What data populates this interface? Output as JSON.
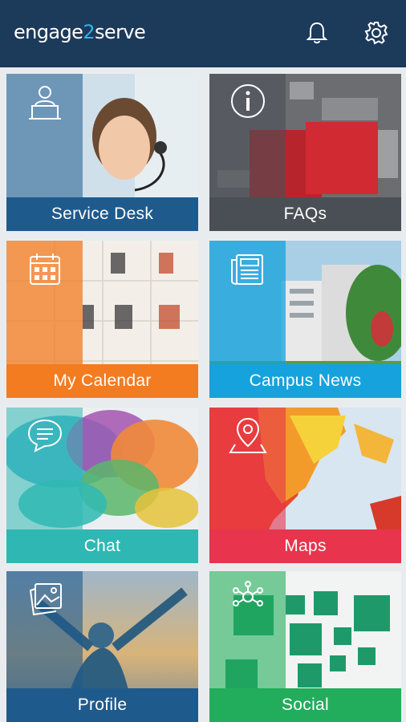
{
  "app": {
    "logo_left": "engage",
    "logo_mid": "2",
    "logo_right": "serve"
  },
  "header": {
    "icons": [
      "bell-icon",
      "gear-icon"
    ]
  },
  "tiles": [
    {
      "id": "service-desk",
      "label": "Service Desk",
      "icon": "user-laptop-icon",
      "color": "#1f5a8c"
    },
    {
      "id": "faqs",
      "label": "FAQs",
      "icon": "info-icon",
      "color": "#4a4f55"
    },
    {
      "id": "my-calendar",
      "label": "My Calendar",
      "icon": "calendar-icon",
      "color": "#f37b20"
    },
    {
      "id": "campus-news",
      "label": "Campus News",
      "icon": "newspaper-icon",
      "color": "#16a2dc"
    },
    {
      "id": "chat",
      "label": "Chat",
      "icon": "chat-bubble-icon",
      "color": "#2fb8b3"
    },
    {
      "id": "maps",
      "label": "Maps",
      "icon": "map-pin-icon",
      "color": "#e8344d"
    },
    {
      "id": "profile",
      "label": "Profile",
      "icon": "photos-icon",
      "color": "#1f5a8c"
    },
    {
      "id": "social",
      "label": "Social",
      "icon": "network-icon",
      "color": "#22ad5c"
    }
  ]
}
